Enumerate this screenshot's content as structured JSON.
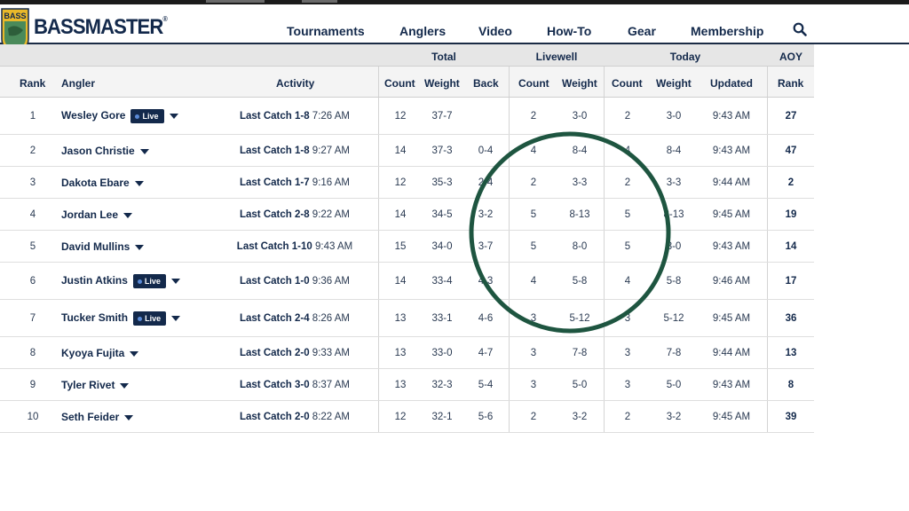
{
  "brand": {
    "name": "BASSMASTER",
    "registered": "®",
    "badge_text": "BASS",
    "colors": {
      "navy": "#13294b",
      "gold": "#e9b92a",
      "green_badge": "#4a8a5a"
    }
  },
  "nav": {
    "items": [
      "Tournaments",
      "Anglers",
      "Video",
      "How-To",
      "Gear",
      "Membership"
    ],
    "search_icon": "search-icon"
  },
  "table": {
    "group_headers": {
      "total": "Total",
      "livewell": "Livewell",
      "today": "Today",
      "aoy": "AOY"
    },
    "columns": {
      "rank": "Rank",
      "angler": "Angler",
      "activity": "Activity",
      "total_count": "Count",
      "total_weight": "Weight",
      "back": "Back",
      "livewell_count": "Count",
      "livewell_weight": "Weight",
      "today_count": "Count",
      "today_weight": "Weight",
      "updated": "Updated",
      "aoy_rank": "Rank"
    },
    "live_label": "Live",
    "rows": [
      {
        "rank": "1",
        "angler": "Wesley Gore",
        "live": true,
        "catch": "Last Catch 1-8",
        "time": "7:26 AM",
        "count": "12",
        "weight": "37-7",
        "back": "",
        "lw_count": "2",
        "lw_weight": "3-0",
        "t_count": "2",
        "t_weight": "3-0",
        "updated": "9:43 AM",
        "aoy": "27"
      },
      {
        "rank": "2",
        "angler": "Jason Christie",
        "live": false,
        "catch": "Last Catch 1-8",
        "time": "9:27 AM",
        "count": "14",
        "weight": "37-3",
        "back": "0-4",
        "lw_count": "4",
        "lw_weight": "8-4",
        "t_count": "4",
        "t_weight": "8-4",
        "updated": "9:43 AM",
        "aoy": "47"
      },
      {
        "rank": "3",
        "angler": "Dakota Ebare",
        "live": false,
        "catch": "Last Catch 1-7",
        "time": "9:16 AM",
        "count": "12",
        "weight": "35-3",
        "back": "2-4",
        "lw_count": "2",
        "lw_weight": "3-3",
        "t_count": "2",
        "t_weight": "3-3",
        "updated": "9:44 AM",
        "aoy": "2"
      },
      {
        "rank": "4",
        "angler": "Jordan Lee",
        "live": false,
        "catch": "Last Catch 2-8",
        "time": "9:22 AM",
        "count": "14",
        "weight": "34-5",
        "back": "3-2",
        "lw_count": "5",
        "lw_weight": "8-13",
        "t_count": "5",
        "t_weight": "8-13",
        "updated": "9:45 AM",
        "aoy": "19"
      },
      {
        "rank": "5",
        "angler": "David Mullins",
        "live": false,
        "catch": "Last Catch 1-10",
        "time": "9:43 AM",
        "count": "15",
        "weight": "34-0",
        "back": "3-7",
        "lw_count": "5",
        "lw_weight": "8-0",
        "t_count": "5",
        "t_weight": "8-0",
        "updated": "9:43 AM",
        "aoy": "14"
      },
      {
        "rank": "6",
        "angler": "Justin Atkins",
        "live": true,
        "catch": "Last Catch 1-0",
        "time": "9:36 AM",
        "count": "14",
        "weight": "33-4",
        "back": "4-3",
        "lw_count": "4",
        "lw_weight": "5-8",
        "t_count": "4",
        "t_weight": "5-8",
        "updated": "9:46 AM",
        "aoy": "17"
      },
      {
        "rank": "7",
        "angler": "Tucker Smith",
        "live": true,
        "catch": "Last Catch 2-4",
        "time": "8:26 AM",
        "count": "13",
        "weight": "33-1",
        "back": "4-6",
        "lw_count": "3",
        "lw_weight": "5-12",
        "t_count": "3",
        "t_weight": "5-12",
        "updated": "9:45 AM",
        "aoy": "36"
      },
      {
        "rank": "8",
        "angler": "Kyoya Fujita",
        "live": false,
        "catch": "Last Catch 2-0",
        "time": "9:33 AM",
        "count": "13",
        "weight": "33-0",
        "back": "4-7",
        "lw_count": "3",
        "lw_weight": "7-8",
        "t_count": "3",
        "t_weight": "7-8",
        "updated": "9:44 AM",
        "aoy": "13"
      },
      {
        "rank": "9",
        "angler": "Tyler Rivet",
        "live": false,
        "catch": "Last Catch 3-0",
        "time": "8:37 AM",
        "count": "13",
        "weight": "32-3",
        "back": "5-4",
        "lw_count": "3",
        "lw_weight": "5-0",
        "t_count": "3",
        "t_weight": "5-0",
        "updated": "9:43 AM",
        "aoy": "8"
      },
      {
        "rank": "10",
        "angler": "Seth Feider",
        "live": false,
        "catch": "Last Catch 2-0",
        "time": "8:22 AM",
        "count": "12",
        "weight": "32-1",
        "back": "5-6",
        "lw_count": "2",
        "lw_weight": "3-2",
        "t_count": "2",
        "t_weight": "3-2",
        "updated": "9:45 AM",
        "aoy": "39"
      }
    ]
  },
  "annotation": {
    "color": "#1e5540"
  }
}
